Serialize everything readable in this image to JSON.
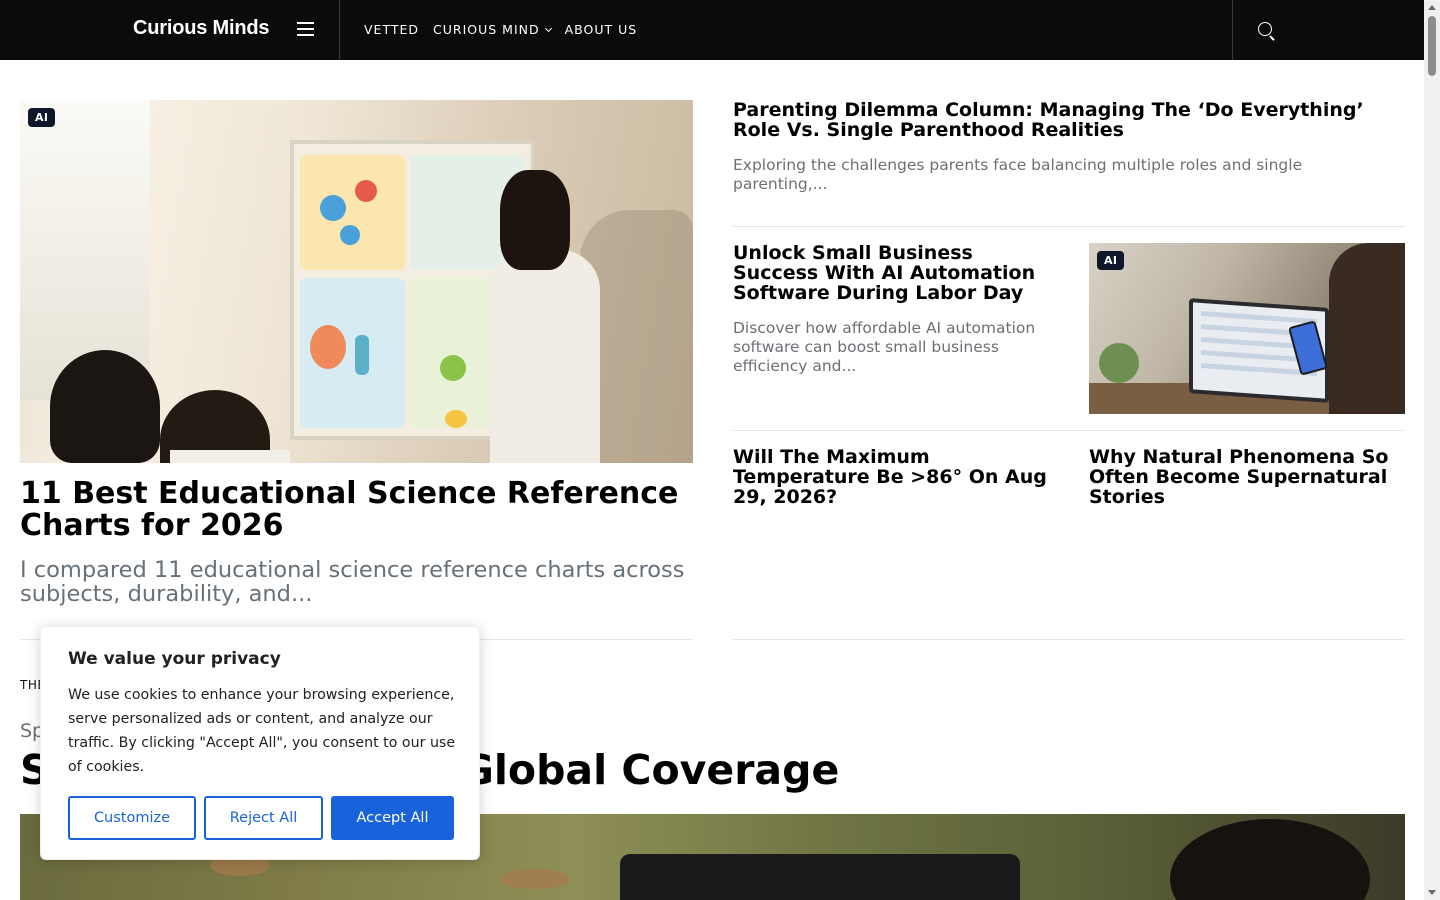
{
  "header": {
    "brand": "Curious Minds",
    "nav": [
      {
        "label": "VETTED",
        "has_dropdown": false
      },
      {
        "label": "CURIOUS MIND",
        "has_dropdown": true
      },
      {
        "label": "ABOUT US",
        "has_dropdown": false
      }
    ],
    "icons": {
      "menu": "hamburger-icon",
      "search": "search-icon"
    }
  },
  "featured": {
    "badge": "AI",
    "title": "11 Best Educational Science Reference Charts for 2026",
    "excerpt": "I compared 11 educational science reference charts across subjects, durability, and..."
  },
  "side_articles": [
    {
      "title": "Parenting Dilemma Column: Managing The ‘Do Everything’ Role Vs. Single Parenthood Realities",
      "excerpt": "Exploring the challenges parents face balancing multiple roles and single parenting,..."
    },
    {
      "title": "Unlock Small Business Success With AI Automation Software During Labor Day",
      "excerpt": "Discover how affordable AI automation software can boost small business efficiency and...",
      "badge": "AI"
    },
    {
      "title": "Will The Maximum Temperature Be >86° On Aug 29, 2026?"
    },
    {
      "title": "Why Natural Phenomena So Often Become Supernatural Stories"
    }
  ],
  "section": {
    "label": "THE",
    "kicker": "Sp",
    "title": "S                    es In Global Coverage"
  },
  "cookie": {
    "title": "We value your privacy",
    "text": "We use cookies to enhance your browsing experience, serve personalized ads or content, and analyze our traffic. By clicking \"Accept All\", you consent to our use of cookies.",
    "buttons": {
      "customize": "Customize",
      "reject": "Reject All",
      "accept": "Accept All"
    },
    "accent": "#1863dc"
  },
  "colors": {
    "header_bg": "#0b0b0b",
    "excerpt": "#687078",
    "badge_bg": "#0f172a"
  }
}
